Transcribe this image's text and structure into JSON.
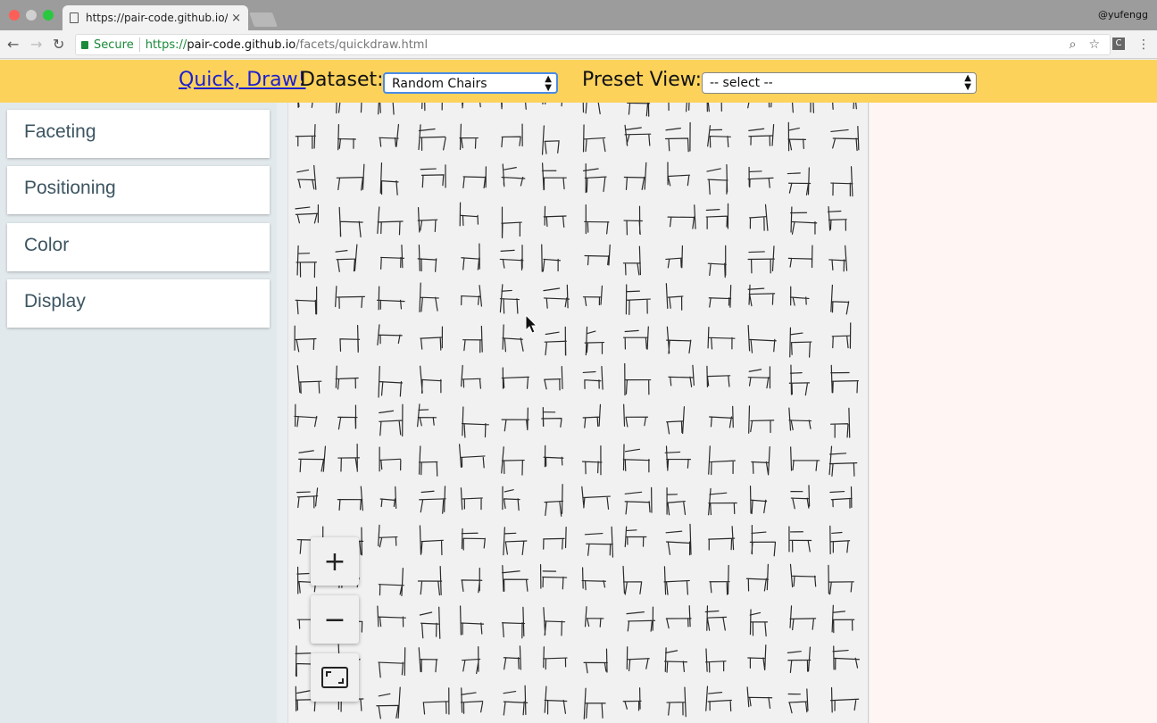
{
  "browser": {
    "tab_title": "https://pair-code.github.io/facets/quickdraw.html",
    "tab_close": "×",
    "user": "@yufengg",
    "secure_label": "Secure",
    "url_scheme": "https://",
    "url_host": "pair-code.github.io",
    "url_path": "/facets/quickdraw.html",
    "extension_label": "C"
  },
  "header": {
    "quickdraw_link": "Quick, Draw!",
    "dataset_label": "Dataset:",
    "dataset_value": "Random Chairs",
    "preset_label": "Preset View:",
    "preset_value": "-- select --"
  },
  "sidebar": {
    "sections": [
      "Faceting",
      "Positioning",
      "Color",
      "Display"
    ]
  },
  "zoom": {
    "zoom_in": "+",
    "zoom_out": "−"
  },
  "colors": {
    "header_bg": "#fcd25b",
    "link": "#1d1fd0",
    "panel_text": "#3c5561",
    "secure_green": "#1a8a3a"
  }
}
